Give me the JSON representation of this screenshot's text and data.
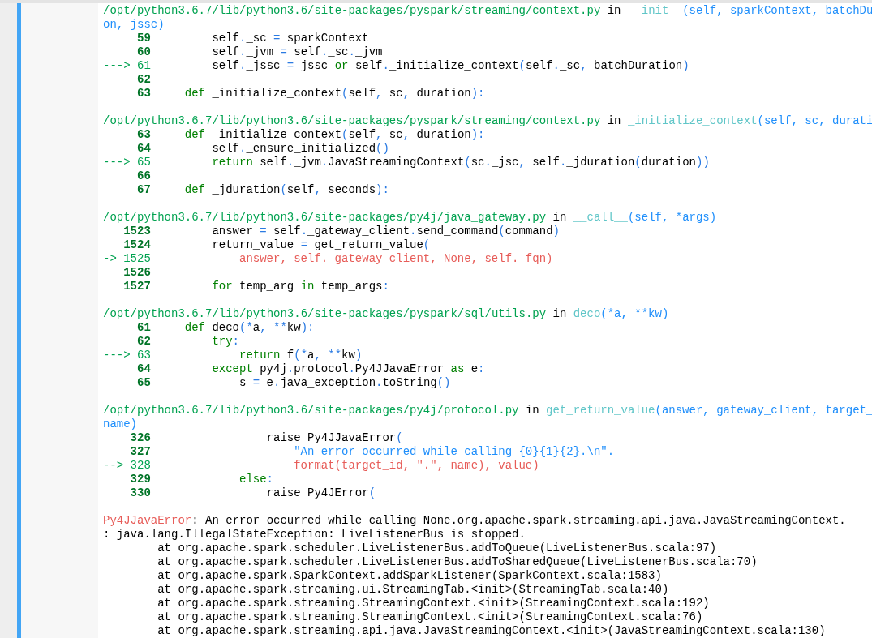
{
  "frames": [
    {
      "header": [
        {
          "kind": "path",
          "text": "/opt/python3.6.7/lib/python3.6/site-packages/pyspark/streaming/context.py"
        },
        {
          "kind": "plain",
          "text": " in "
        },
        {
          "kind": "func",
          "text": "__init__"
        },
        {
          "kind": "args",
          "text": "(self, sparkContext, batchDu"
        }
      ],
      "header_wrap": [
        {
          "kind": "args",
          "text": "on, jssc)"
        }
      ],
      "lines": [
        {
          "number": "59",
          "current": false,
          "code": [
            {
              "kind": "code",
              "text": "        self._sc = sparkContext"
            }
          ]
        },
        {
          "number": "60",
          "current": false,
          "code": [
            {
              "kind": "code",
              "text": "        self._jvm = self._sc._jvm"
            }
          ]
        },
        {
          "number": "61",
          "current": true,
          "arrow": "--->",
          "code": [
            {
              "kind": "code",
              "text": "        self._jssc = jssc "
            },
            {
              "kind": "kw",
              "text": "or"
            },
            {
              "kind": "code",
              "text": " self._initialize_context(self._sc, batchDuration)"
            }
          ]
        },
        {
          "number": "62",
          "current": false
        },
        {
          "number": "63",
          "current": false,
          "code": [
            {
              "kind": "kw",
              "text": "    def"
            },
            {
              "kind": "code",
              "text": " _initialize_context(self, sc, duration):"
            }
          ]
        }
      ]
    },
    {
      "header": [
        {
          "kind": "path",
          "text": "/opt/python3.6.7/lib/python3.6/site-packages/pyspark/streaming/context.py"
        },
        {
          "kind": "plain",
          "text": " in "
        },
        {
          "kind": "func",
          "text": "_initialize_context"
        },
        {
          "kind": "args",
          "text": "(self, sc, durati"
        }
      ],
      "lines": [
        {
          "number": "63",
          "current": false,
          "code": [
            {
              "kind": "kw",
              "text": "    def"
            },
            {
              "kind": "code",
              "text": " _initialize_context(self, sc, duration):"
            }
          ]
        },
        {
          "number": "64",
          "current": false,
          "code": [
            {
              "kind": "code",
              "text": "        self._ensure_initialized()"
            }
          ]
        },
        {
          "number": "65",
          "current": true,
          "arrow": "--->",
          "code": [
            {
              "kind": "kw",
              "text": "        return"
            },
            {
              "kind": "code",
              "text": " self._jvm.JavaStreamingContext(sc._jsc, self._jduration(duration))"
            }
          ]
        },
        {
          "number": "66",
          "current": false
        },
        {
          "number": "67",
          "current": false,
          "code": [
            {
              "kind": "kw",
              "text": "    def"
            },
            {
              "kind": "code",
              "text": " _jduration(self, seconds):"
            }
          ]
        }
      ]
    },
    {
      "header": [
        {
          "kind": "path",
          "text": "/opt/python3.6.7/lib/python3.6/site-packages/py4j/java_gateway.py"
        },
        {
          "kind": "plain",
          "text": " in "
        },
        {
          "kind": "func",
          "text": "__call__"
        },
        {
          "kind": "args",
          "text": "(self, *args)"
        }
      ],
      "lines": [
        {
          "number": "1523",
          "current": false,
          "code": [
            {
              "kind": "code",
              "text": "        answer = self._gateway_client.send_command(command)"
            }
          ]
        },
        {
          "number": "1524",
          "current": false,
          "code": [
            {
              "kind": "code",
              "text": "        return_value = get_return_value("
            }
          ]
        },
        {
          "number": "1525",
          "current": true,
          "arrow": "->",
          "code": [
            {
              "kind": "err",
              "text": "            answer, self._gateway_client, None, self._fqn)"
            }
          ]
        },
        {
          "number": "1526",
          "current": false
        },
        {
          "number": "1527",
          "current": false,
          "code": [
            {
              "kind": "kw",
              "text": "        for"
            },
            {
              "kind": "code",
              "text": " temp_arg "
            },
            {
              "kind": "kw",
              "text": "in"
            },
            {
              "kind": "code",
              "text": " temp_args:"
            }
          ]
        }
      ]
    },
    {
      "header": [
        {
          "kind": "path",
          "text": "/opt/python3.6.7/lib/python3.6/site-packages/pyspark/sql/utils.py"
        },
        {
          "kind": "plain",
          "text": " in "
        },
        {
          "kind": "func",
          "text": "deco"
        },
        {
          "kind": "args",
          "text": "(*a, **kw)"
        }
      ],
      "lines": [
        {
          "number": "61",
          "current": false,
          "code": [
            {
              "kind": "kw",
              "text": "    def"
            },
            {
              "kind": "code",
              "text": " deco(*a, **kw):"
            }
          ]
        },
        {
          "number": "62",
          "current": false,
          "code": [
            {
              "kind": "kw",
              "text": "        try"
            },
            {
              "kind": "code",
              "text": ":"
            }
          ]
        },
        {
          "number": "63",
          "current": true,
          "arrow": "--->",
          "code": [
            {
              "kind": "kw",
              "text": "            return"
            },
            {
              "kind": "code",
              "text": " f(*a, **kw)"
            }
          ]
        },
        {
          "number": "64",
          "current": false,
          "code": [
            {
              "kind": "kw",
              "text": "        except"
            },
            {
              "kind": "code",
              "text": " py4j.protocol.Py4JJavaError "
            },
            {
              "kind": "kw",
              "text": "as"
            },
            {
              "kind": "code",
              "text": " e:"
            }
          ]
        },
        {
          "number": "65",
          "current": false,
          "code": [
            {
              "kind": "code",
              "text": "            s = e.java_exception.toString()"
            }
          ]
        }
      ]
    },
    {
      "header": [
        {
          "kind": "path",
          "text": "/opt/python3.6.7/lib/python3.6/site-packages/py4j/protocol.py"
        },
        {
          "kind": "plain",
          "text": " in "
        },
        {
          "kind": "func",
          "text": "get_return_value"
        },
        {
          "kind": "args",
          "text": "(answer, gateway_client, target_"
        }
      ],
      "header_wrap": [
        {
          "kind": "args",
          "text": "name)"
        }
      ],
      "lines": [
        {
          "number": "326",
          "current": false,
          "code": [
            {
              "kind": "code",
              "text": "                raise Py4JJavaError("
            }
          ]
        },
        {
          "number": "327",
          "current": false,
          "code": [
            {
              "kind": "str",
              "text": "                    \"An error occurred while calling {0}{1}{2}.\\n\"."
            }
          ]
        },
        {
          "number": "328",
          "current": true,
          "arrow": "-->",
          "code": [
            {
              "kind": "err",
              "text": "                    format(target_id, \".\", name), value)"
            }
          ]
        },
        {
          "number": "329",
          "current": false,
          "code": [
            {
              "kind": "kw",
              "text": "            else"
            },
            {
              "kind": "code",
              "text": ":"
            }
          ]
        },
        {
          "number": "330",
          "current": false,
          "code": [
            {
              "kind": "code",
              "text": "                raise Py4JError("
            }
          ]
        }
      ]
    }
  ],
  "error": {
    "name": "Py4JJavaError",
    "message": ": An error occurred while calling None.org.apache.spark.streaming.api.java.JavaStreamingContext.",
    "trace": [
      ": java.lang.IllegalStateException: LiveListenerBus is stopped.",
      "\tat org.apache.spark.scheduler.LiveListenerBus.addToQueue(LiveListenerBus.scala:97)",
      "\tat org.apache.spark.scheduler.LiveListenerBus.addToSharedQueue(LiveListenerBus.scala:70)",
      "\tat org.apache.spark.SparkContext.addSparkListener(SparkContext.scala:1583)",
      "\tat org.apache.spark.streaming.ui.StreamingTab.<init>(StreamingTab.scala:40)",
      "\tat org.apache.spark.streaming.StreamingContext.<init>(StreamingContext.scala:192)",
      "\tat org.apache.spark.streaming.StreamingContext.<init>(StreamingContext.scala:76)",
      "\tat org.apache.spark.streaming.api.java.JavaStreamingContext.<init>(JavaStreamingContext.scala:130)"
    ]
  }
}
